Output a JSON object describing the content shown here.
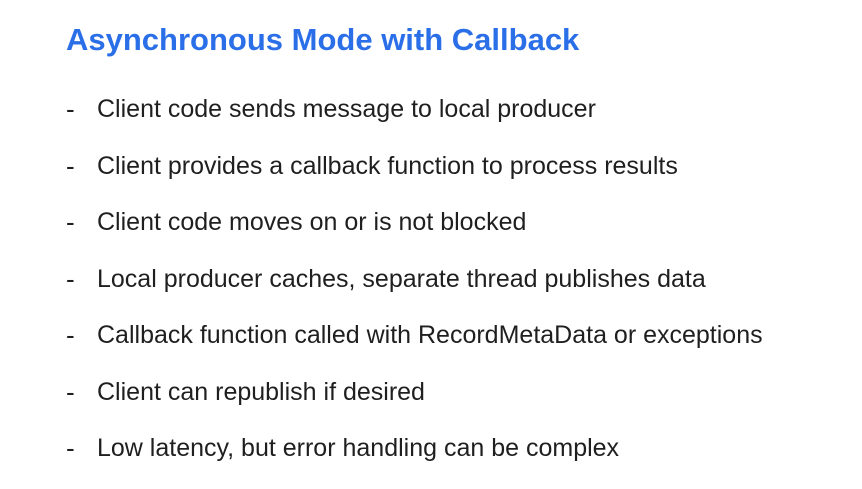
{
  "slide": {
    "title": "Asynchronous Mode with Callback",
    "title_color": "#2b6fe8",
    "text_color": "#1f1f1f",
    "bullet_marker": "-",
    "bullets": [
      "Client code sends message to local producer",
      "Client provides a callback function to process results",
      "Client code moves on or is not blocked",
      "Local producer caches, separate thread publishes data",
      "Callback function called with RecordMetaData or exceptions",
      "Client can republish if desired",
      "Low latency, but error handling can be complex"
    ]
  }
}
